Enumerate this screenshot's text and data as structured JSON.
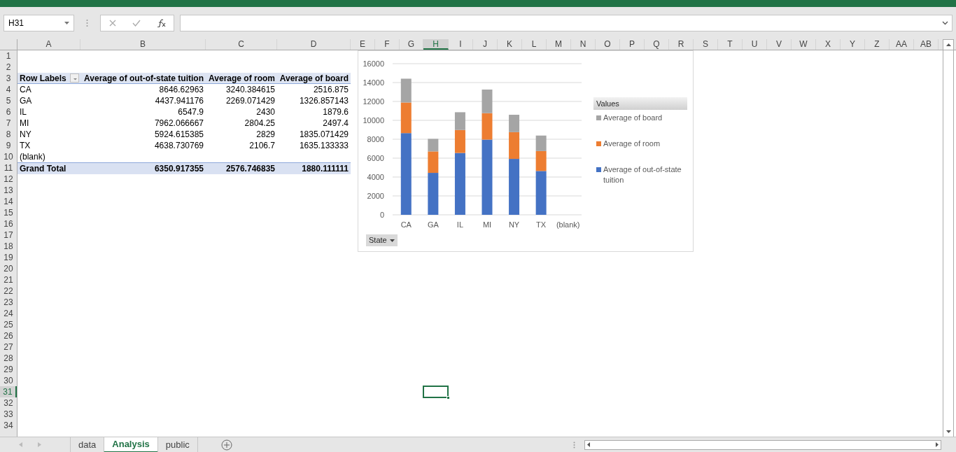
{
  "name_box": "H31",
  "columns": [
    {
      "label": "A",
      "selected": false
    },
    {
      "label": "B",
      "selected": false
    },
    {
      "label": "C",
      "selected": false
    },
    {
      "label": "D",
      "selected": false
    },
    {
      "label": "E",
      "selected": false
    },
    {
      "label": "F",
      "selected": false
    },
    {
      "label": "G",
      "selected": false
    },
    {
      "label": "H",
      "selected": true
    },
    {
      "label": "I",
      "selected": false
    },
    {
      "label": "J",
      "selected": false
    },
    {
      "label": "K",
      "selected": false
    },
    {
      "label": "L",
      "selected": false
    },
    {
      "label": "M",
      "selected": false
    },
    {
      "label": "N",
      "selected": false
    },
    {
      "label": "O",
      "selected": false
    },
    {
      "label": "P",
      "selected": false
    },
    {
      "label": "Q",
      "selected": false
    },
    {
      "label": "R",
      "selected": false
    },
    {
      "label": "S",
      "selected": false
    },
    {
      "label": "T",
      "selected": false
    },
    {
      "label": "U",
      "selected": false
    },
    {
      "label": "V",
      "selected": false
    },
    {
      "label": "W",
      "selected": false
    },
    {
      "label": "X",
      "selected": false
    },
    {
      "label": "Y",
      "selected": false
    },
    {
      "label": "Z",
      "selected": false
    },
    {
      "label": "AA",
      "selected": false
    },
    {
      "label": "AB",
      "selected": false
    }
  ],
  "rows": [
    {
      "label": "1",
      "selected": false
    },
    {
      "label": "2",
      "selected": false
    },
    {
      "label": "3",
      "selected": false
    },
    {
      "label": "4",
      "selected": false
    },
    {
      "label": "5",
      "selected": false
    },
    {
      "label": "6",
      "selected": false
    },
    {
      "label": "7",
      "selected": false
    },
    {
      "label": "8",
      "selected": false
    },
    {
      "label": "9",
      "selected": false
    },
    {
      "label": "10",
      "selected": false
    },
    {
      "label": "11",
      "selected": false
    },
    {
      "label": "12",
      "selected": false
    },
    {
      "label": "13",
      "selected": false
    },
    {
      "label": "14",
      "selected": false
    },
    {
      "label": "15",
      "selected": false
    },
    {
      "label": "16",
      "selected": false
    },
    {
      "label": "17",
      "selected": false
    },
    {
      "label": "18",
      "selected": false
    },
    {
      "label": "19",
      "selected": false
    },
    {
      "label": "20",
      "selected": false
    },
    {
      "label": "21",
      "selected": false
    },
    {
      "label": "22",
      "selected": false
    },
    {
      "label": "23",
      "selected": false
    },
    {
      "label": "24",
      "selected": false
    },
    {
      "label": "25",
      "selected": false
    },
    {
      "label": "26",
      "selected": false
    },
    {
      "label": "27",
      "selected": false
    },
    {
      "label": "28",
      "selected": false
    },
    {
      "label": "29",
      "selected": false
    },
    {
      "label": "30",
      "selected": false
    },
    {
      "label": "31",
      "selected": true
    },
    {
      "label": "32",
      "selected": false
    },
    {
      "label": "33",
      "selected": false
    },
    {
      "label": "34",
      "selected": false
    }
  ],
  "pivot": {
    "headers": [
      "Row Labels",
      "Average of out-of-state tuition",
      "Average of room",
      "Average of board"
    ],
    "rows": [
      [
        "CA",
        "8646.62963",
        "3240.384615",
        "2516.875"
      ],
      [
        "GA",
        "4437.941176",
        "2269.071429",
        "1326.857143"
      ],
      [
        "IL",
        "6547.9",
        "2430",
        "1879.6"
      ],
      [
        "MI",
        "7962.066667",
        "2804.25",
        "2497.4"
      ],
      [
        "NY",
        "5924.615385",
        "2829",
        "1835.071429"
      ],
      [
        "TX",
        "4638.730769",
        "2106.7",
        "1635.133333"
      ],
      [
        "(blank)"
      ]
    ],
    "total": [
      "Grand Total",
      "6350.917355",
      "2576.746835",
      "1880.111111"
    ]
  },
  "chart": {
    "legend_title": "Values",
    "filter_button": "State",
    "chart_data": {
      "type": "bar",
      "stacked": true,
      "orientation": "vertical",
      "grid": true,
      "categories": [
        "CA",
        "GA",
        "IL",
        "MI",
        "NY",
        "TX",
        "(blank)"
      ],
      "series": [
        {
          "name": "Average of out-of-state tuition",
          "color": "#4472c4",
          "values": [
            8650,
            4440,
            6550,
            7960,
            5920,
            4640,
            null
          ]
        },
        {
          "name": "Average of room",
          "color": "#ed7d31",
          "values": [
            3240,
            2270,
            2430,
            2800,
            2830,
            2110,
            null
          ]
        },
        {
          "name": "Average of board",
          "color": "#a5a5a5",
          "values": [
            2520,
            1330,
            1880,
            2500,
            1840,
            1640,
            null
          ]
        }
      ],
      "ylim": [
        0,
        16000
      ],
      "yticks": [
        0,
        2000,
        4000,
        6000,
        8000,
        10000,
        12000,
        14000,
        16000
      ]
    }
  },
  "sheet_tabs": [
    {
      "label": "data",
      "selected": false
    },
    {
      "label": "Analysis",
      "selected": true
    },
    {
      "label": "public",
      "selected": false
    }
  ]
}
